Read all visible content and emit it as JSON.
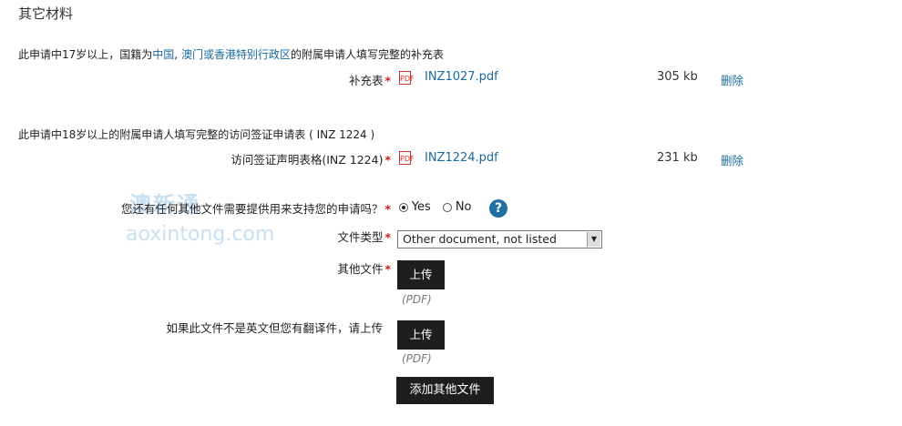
{
  "section_title": "其它材料",
  "note1": {
    "prefix": "此申请中17岁以上，国籍为",
    "link1": "中国",
    "sep": ", ",
    "link2": "澳门或香港特别行政区",
    "suffix": "的附属申请人填写完整的补充表"
  },
  "row1": {
    "label": "补充表",
    "file": "INZ1027.pdf",
    "size": "305 kb",
    "delete": "删除"
  },
  "note2": "此申请中18岁以上的附属申请人填写完整的访问签证申请表 ( INZ 1224 )",
  "row2": {
    "label": "访问签证声明表格(INZ 1224)",
    "file": "INZ1224.pdf",
    "size": "231 kb",
    "delete": "删除"
  },
  "question": {
    "label": "您还有任何其他文件需要提供用来支持您的申请吗？",
    "yes": "Yes",
    "no": "No",
    "selected": "Yes",
    "help": "?"
  },
  "doc_type": {
    "label": "文件类型",
    "value": "Other document, not listed"
  },
  "other_file": {
    "label": "其他文件",
    "button": "上传",
    "hint": "(PDF)"
  },
  "translation": {
    "label": "如果此文件不是英文但您有翻译件，请上传",
    "button": "上传",
    "hint": "(PDF)"
  },
  "add_button": "添加其他文件",
  "watermark": {
    "cn": "澳新通",
    "en": "aoxintong.com"
  },
  "required_mark": "*",
  "pdf_icon_text": "PDF",
  "colors": {
    "link": "#1a6aa0",
    "required": "#d21d1d",
    "button": "#1e1e1e",
    "help": "#1f6fa3"
  }
}
